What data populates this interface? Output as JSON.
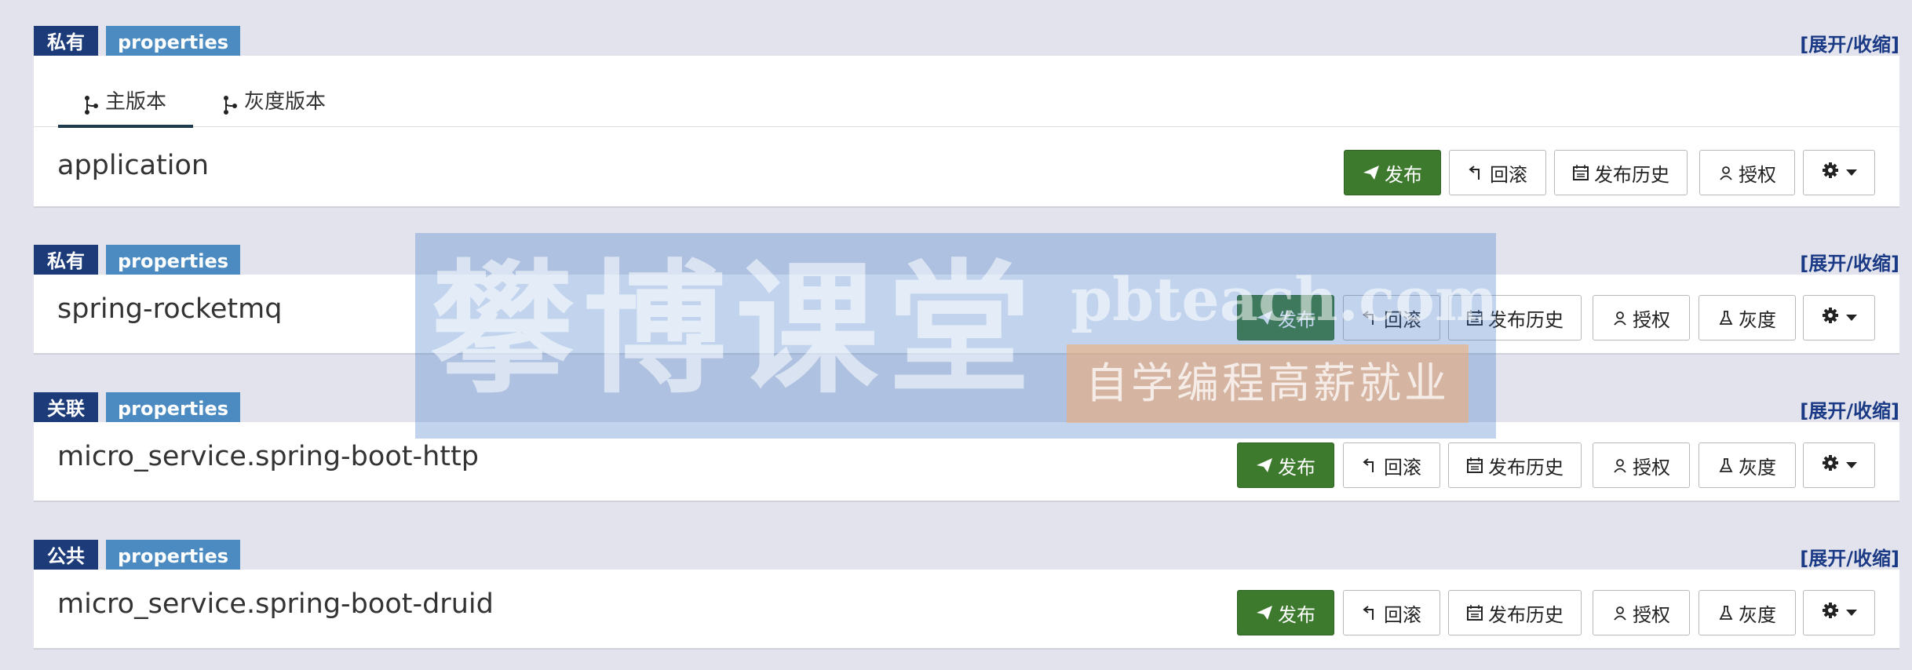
{
  "panels": [
    {
      "scope": "私有",
      "format": "properties",
      "toggle": "[展开/收缩]",
      "tabs": [
        "主版本",
        "灰度版本"
      ],
      "name": "application",
      "buttons": {
        "publish": "发布",
        "rollback": "回滚",
        "history": "发布历史",
        "authorize": "授权"
      }
    },
    {
      "scope": "私有",
      "format": "properties",
      "toggle": "[展开/收缩]",
      "name": "spring-rocketmq",
      "buttons": {
        "publish": "发布",
        "rollback": "回滚",
        "history": "发布历史",
        "authorize": "授权",
        "gray": "灰度"
      }
    },
    {
      "scope": "关联",
      "format": "properties",
      "toggle": "[展开/收缩]",
      "name": "micro_service.spring-boot-http",
      "buttons": {
        "publish": "发布",
        "rollback": "回滚",
        "history": "发布历史",
        "authorize": "授权",
        "gray": "灰度"
      }
    },
    {
      "scope": "公共",
      "format": "properties",
      "toggle": "[展开/收缩]",
      "name": "micro_service.spring-boot-druid",
      "buttons": {
        "publish": "发布",
        "rollback": "回滚",
        "history": "发布历史",
        "authorize": "授权",
        "gray": "灰度"
      }
    }
  ],
  "watermark": {
    "brand": "攀博课堂",
    "url": "pbteach.com",
    "slogan": "自学编程高薪就业"
  },
  "colors": {
    "scope_tag": "#1c3b78",
    "format_tag": "#4b8bc1",
    "publish_button": "#3d7a2d",
    "toggle_link": "#1b3a86"
  }
}
